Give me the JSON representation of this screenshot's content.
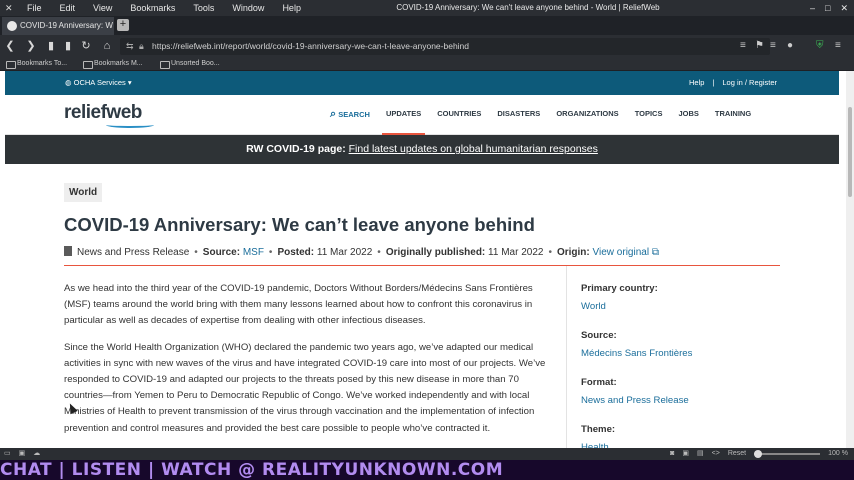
{
  "browser": {
    "menus": [
      "File",
      "Edit",
      "View",
      "Bookmarks",
      "Tools",
      "Window",
      "Help"
    ],
    "window_title": "COVID-19 Anniversary: We can't leave anyone behind - World | ReliefWeb",
    "tab_title": "COVID-19 Anniversary: W",
    "url": "https://reliefweb.int/report/world/covid-19-anniversary-we-can-t-leave-anyone-behind",
    "bookmarks": [
      "Bookmarks To...",
      "Bookmarks M...",
      "Unsorted Boo..."
    ],
    "status": {
      "zoom_reset": "Reset",
      "zoom": "100 %"
    }
  },
  "site": {
    "ocha_services": "OCHA Services",
    "help": "Help",
    "separator": "|",
    "login": "Log in / Register",
    "logo": "reliefweb",
    "nav": [
      "SEARCH",
      "UPDATES",
      "COUNTRIES",
      "DISASTERS",
      "ORGANIZATIONS",
      "TOPICS",
      "JOBS",
      "TRAINING"
    ],
    "banner": {
      "label": "RW COVID-19 page:",
      "link": "Find latest updates on global humanitarian responses"
    }
  },
  "article": {
    "tag": "World",
    "title": "COVID-19 Anniversary: We can’t leave anyone behind",
    "meta": {
      "type": "News and Press Release",
      "source_label": "Source:",
      "source": "MSF",
      "posted_label": "Posted:",
      "posted": "11 Mar 2022",
      "published_label": "Originally published:",
      "published": "11 Mar 2022",
      "origin_label": "Origin:",
      "origin": "View original"
    },
    "paragraphs": [
      "As we head into the third year of the COVID-19 pandemic, Doctors Without Borders/Médecins Sans Frontières (MSF) teams around the world bring with them many lessons learned about how to confront this coronavirus in particular as well as decades of expertise from dealing with other infectious diseases.",
      "Since the World Health Organization (WHO) declared the pandemic two years ago, we’ve adapted our medical activities in sync with new waves of the virus and have integrated COVID-19 care into most of our projects. We’ve responded to COVID-19 and adapted our projects to the threats posed by this new disease in more than 70 countries—from Yemen to Peru to Democratic Republic of Congo. We’ve worked independently and with local Ministries of Health to prevent transmission of the virus through vaccination and the implementation of infection prevention and control measures and provided the best care possible to people who’ve contracted it."
    ]
  },
  "sidebar": {
    "primary_country_label": "Primary country:",
    "primary_country": "World",
    "source_label": "Source:",
    "source": "Médecins Sans Frontières",
    "format_label": "Format:",
    "format": "News and Press Release",
    "theme_label": "Theme:",
    "theme": "Health"
  },
  "overlay_text": "CHAT | LISTEN | WATCH @ REALITYUNKNOWN.COM"
}
